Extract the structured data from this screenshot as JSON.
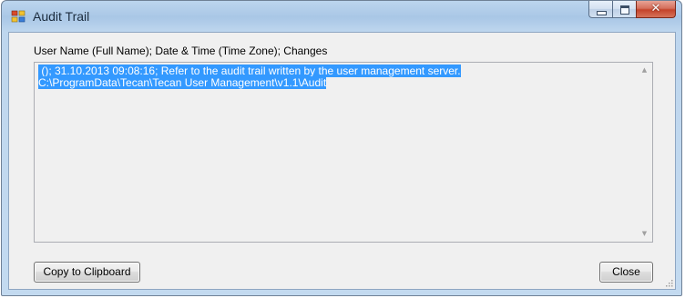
{
  "window": {
    "title": "Audit Trail",
    "icon": "audit-trail-app-icon",
    "caption_buttons": [
      "minimize-icon",
      "maximize-icon",
      "close-icon"
    ]
  },
  "audit": {
    "column_header": "User Name (Full Name); Date & Time (Time Zone); Changes",
    "lines": [
      " (); 31.10.2013 09:08:16; Refer to the audit trail written by the user management server.",
      "C:\\ProgramData\\Tecan\\Tecan User Management\\v1.1\\Audit"
    ],
    "selection_color": "#3399ff"
  },
  "buttons": {
    "copy_label": "Copy to Clipboard",
    "close_label": "Close"
  },
  "colors": {
    "title_bar": "#a9c7e6",
    "client_background": "#f0f0f0",
    "close_button": "#c4432a"
  }
}
